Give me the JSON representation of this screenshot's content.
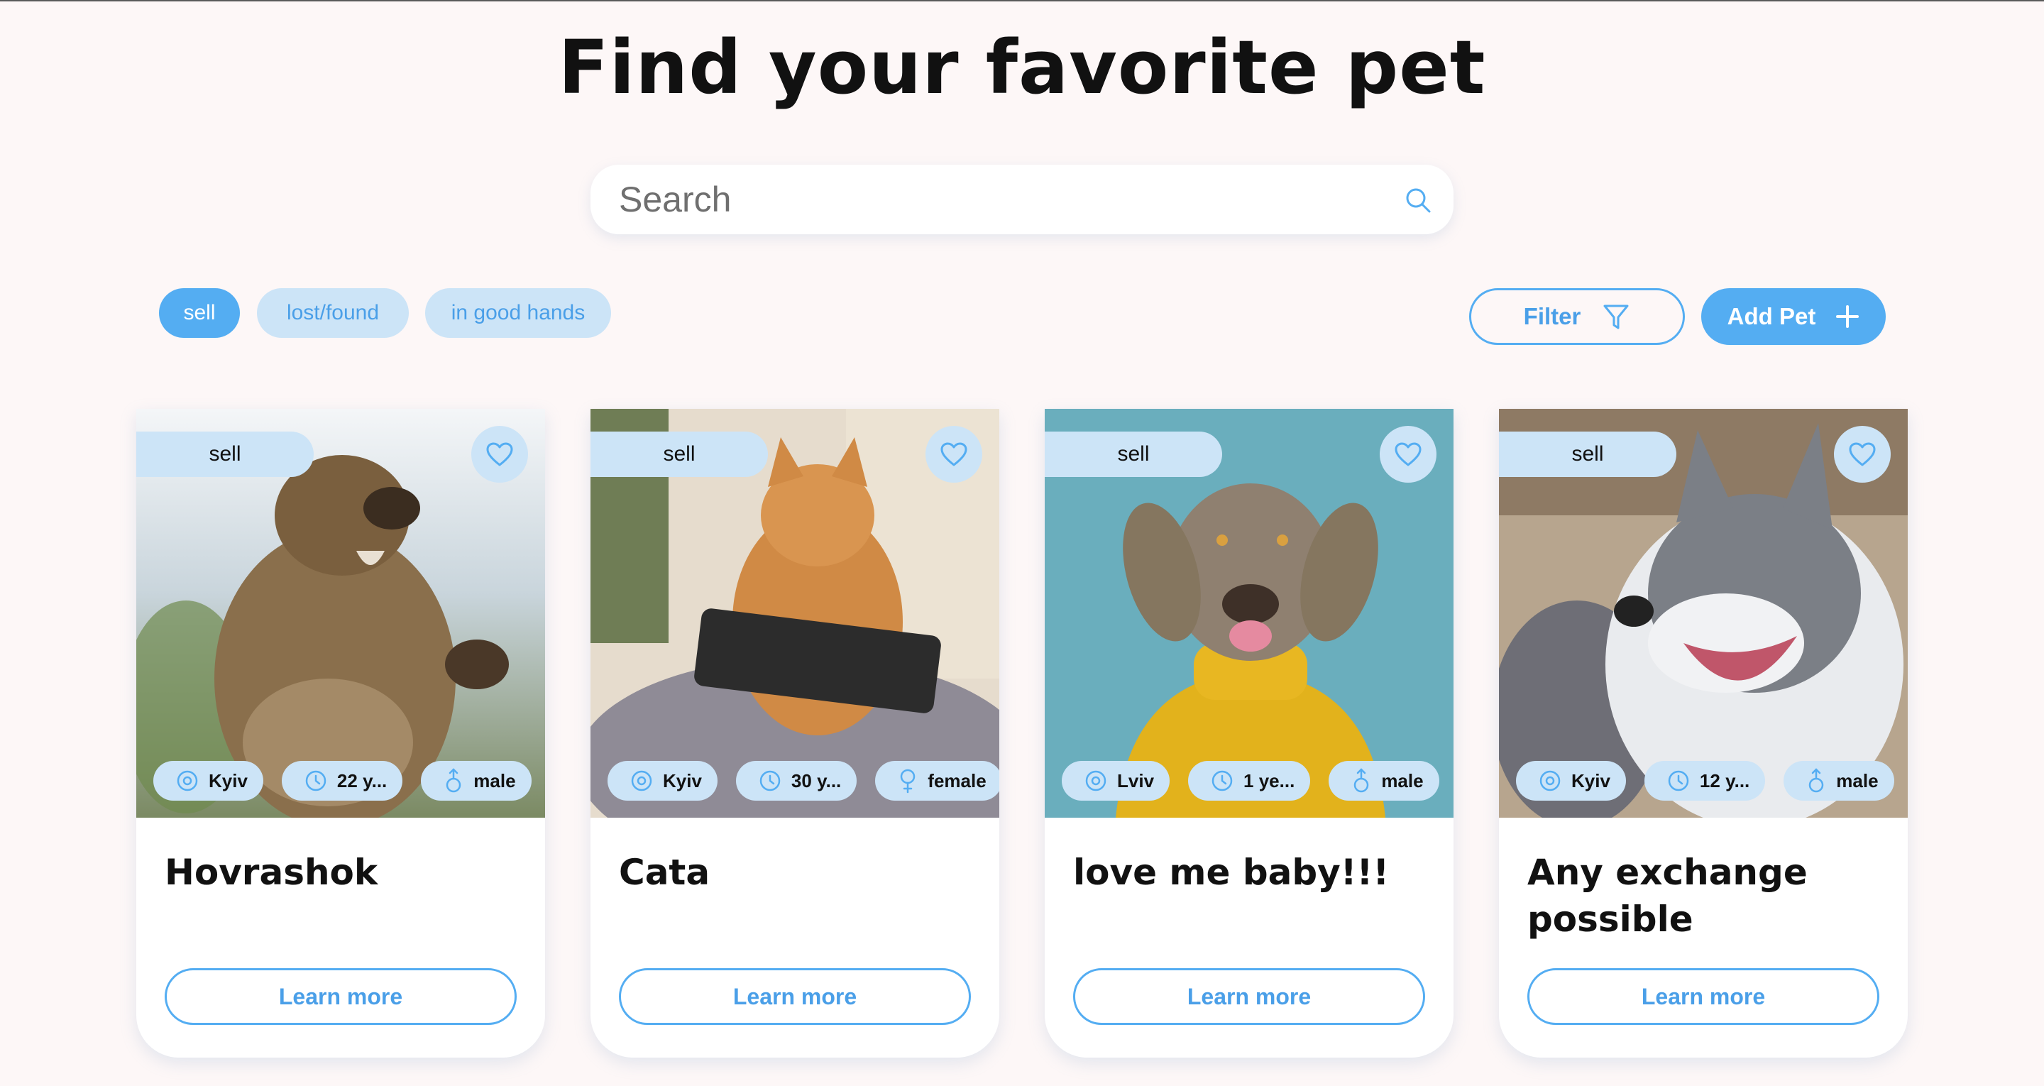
{
  "page": {
    "title": "Find your favorite pet"
  },
  "search": {
    "placeholder": "Search"
  },
  "categories": [
    {
      "label": "sell",
      "active": true
    },
    {
      "label": "lost/found",
      "active": false
    },
    {
      "label": "in good hands",
      "active": false
    }
  ],
  "actions": {
    "filter_label": "Filter",
    "add_pet_label": "Add Pet"
  },
  "cards": [
    {
      "category": "sell",
      "location": "Kyiv",
      "age": "22 y...",
      "sex": "male",
      "title": "Hovrashok",
      "button": "Learn more"
    },
    {
      "category": "sell",
      "location": "Kyiv",
      "age": "30 y...",
      "sex": "female",
      "title": "Cata",
      "button": "Learn more"
    },
    {
      "category": "sell",
      "location": "Lviv",
      "age": "1 ye...",
      "sex": "male",
      "title": "love me baby!!!",
      "button": "Learn more"
    },
    {
      "category": "sell",
      "location": "Kyiv",
      "age": "12 y...",
      "sex": "male",
      "title": "Any exchange possible",
      "button": "Learn more"
    }
  ],
  "colors": {
    "background": "#fdf7f7",
    "accent": "#54adf2",
    "chip_light": "#cce4f7"
  }
}
